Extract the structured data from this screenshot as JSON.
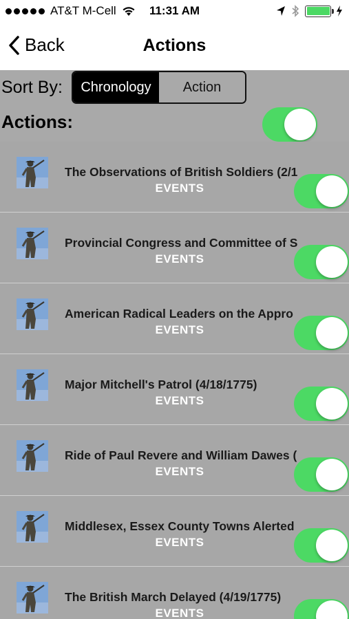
{
  "status_bar": {
    "signal_dots_filled": 5,
    "carrier": "AT&T M-Cell",
    "time": "11:31 AM",
    "battery_level": 1.0,
    "battery_color": "#4cd964",
    "icons": [
      "signal-dots-icon",
      "wifi-icon",
      "location-arrow-icon",
      "bluetooth-icon",
      "battery-icon",
      "charging-bolt-icon"
    ]
  },
  "nav": {
    "back_label": "Back",
    "title": "Actions"
  },
  "sort": {
    "label": "Sort By:",
    "options": [
      "Chronology",
      "Action"
    ],
    "selected": "Chronology"
  },
  "actions_header": {
    "label": "Actions:",
    "toggle_on": true
  },
  "colors": {
    "toggle_on": "#4cd964",
    "list_bg": "#a7a7a7"
  },
  "items": [
    {
      "title": "The Observations of British Soldiers (2/1",
      "category": "EVENTS",
      "enabled": true,
      "thumbnail": "minuteman-statue-icon"
    },
    {
      "title": "Provincial Congress and Committee of S",
      "category": "EVENTS",
      "enabled": true,
      "thumbnail": "minuteman-statue-icon"
    },
    {
      "title": "American Radical Leaders on the Appro",
      "category": "EVENTS",
      "enabled": true,
      "thumbnail": "minuteman-statue-icon"
    },
    {
      "title": "Major Mitchell's Patrol (4/18/1775)",
      "category": "EVENTS",
      "enabled": true,
      "thumbnail": "minuteman-statue-icon"
    },
    {
      "title": "Ride of Paul Revere and William Dawes (",
      "category": "EVENTS",
      "enabled": true,
      "thumbnail": "minuteman-statue-icon"
    },
    {
      "title": "Middlesex, Essex County Towns Alerted",
      "category": "EVENTS",
      "enabled": true,
      "thumbnail": "minuteman-statue-icon"
    },
    {
      "title": "The British March Delayed (4/19/1775)",
      "category": "EVENTS",
      "enabled": true,
      "thumbnail": "minuteman-statue-icon"
    }
  ]
}
